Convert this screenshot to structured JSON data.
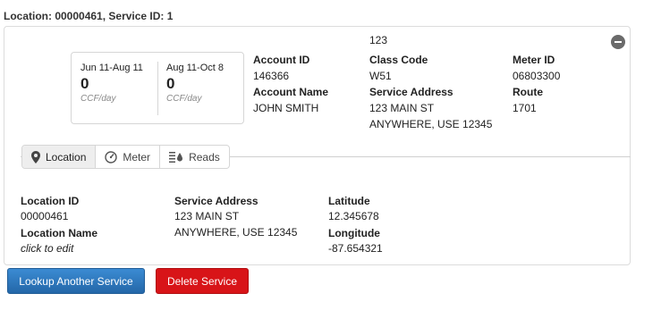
{
  "page": {
    "heading": "Location: 00000461, Service ID: 1"
  },
  "summary": {
    "top_value": "123",
    "usage": [
      {
        "period": "Jun 11-Aug 11",
        "value": "0",
        "unit": "CCF/day"
      },
      {
        "period": "Aug 11-Oct 8",
        "value": "0",
        "unit": "CCF/day"
      }
    ],
    "account_id": {
      "label": "Account ID",
      "value": "146366"
    },
    "account_name": {
      "label": "Account Name",
      "value": "JOHN SMITH"
    },
    "class_code": {
      "label": "Class Code",
      "value": "W51"
    },
    "service_address": {
      "label": "Service Address",
      "line1": "123 MAIN ST",
      "line2": "ANYWHERE, USE 12345"
    },
    "meter_id": {
      "label": "Meter ID",
      "value": "06803300"
    },
    "route": {
      "label": "Route",
      "value": "1701"
    }
  },
  "tabs": [
    {
      "label": "Location",
      "icon": "map-pin-icon",
      "active": true
    },
    {
      "label": "Meter",
      "icon": "gauge-icon",
      "active": false
    },
    {
      "label": "Reads",
      "icon": "reads-icon",
      "active": false
    }
  ],
  "location": {
    "location_id": {
      "label": "Location ID",
      "value": "00000461"
    },
    "location_name": {
      "label": "Location Name",
      "value": "click to edit"
    },
    "service_address": {
      "label": "Service Address",
      "line1": "123 MAIN ST",
      "line2": "ANYWHERE, USE 12345"
    },
    "latitude": {
      "label": "Latitude",
      "value": "12.345678"
    },
    "longitude": {
      "label": "Longitude",
      "value": "-87.654321"
    }
  },
  "buttons": {
    "lookup": "Lookup Another Service",
    "delete": "Delete Service"
  },
  "colors": {
    "primary": "#2f7bc2",
    "danger": "#d81418",
    "border": "#dcdcdc"
  }
}
